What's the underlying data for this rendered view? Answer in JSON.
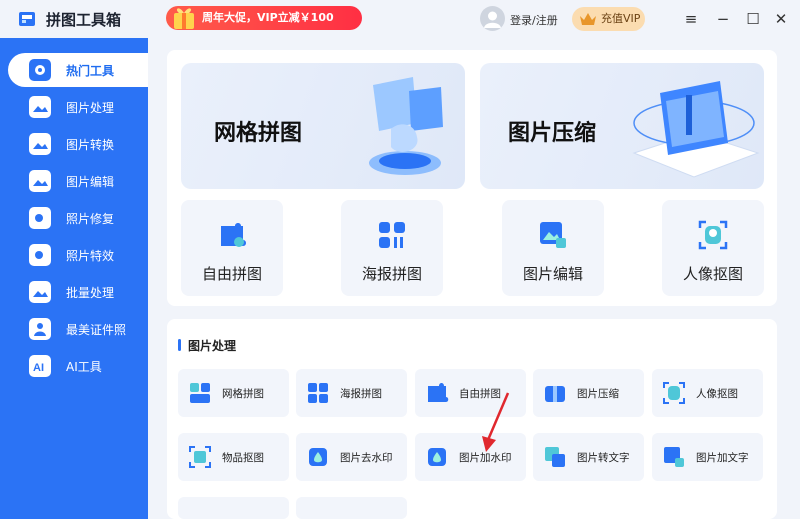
{
  "app": {
    "title": "拼图工具箱"
  },
  "header": {
    "promo_text": "周年大促，VIP立减￥100",
    "login_label": "登录/注册",
    "vip_label": "充值VIP",
    "window_controls": [
      "≡",
      "−",
      "☐",
      "✕"
    ]
  },
  "sidebar": {
    "items": [
      {
        "label": "热门工具",
        "icon": "gear-icon",
        "active": true
      },
      {
        "label": "图片处理",
        "icon": "image-process-icon"
      },
      {
        "label": "图片转换",
        "icon": "image-convert-icon"
      },
      {
        "label": "图片编辑",
        "icon": "image-edit-icon"
      },
      {
        "label": "照片修复",
        "icon": "photo-repair-icon"
      },
      {
        "label": "照片特效",
        "icon": "photo-effect-icon"
      },
      {
        "label": "批量处理",
        "icon": "batch-icon"
      },
      {
        "label": "最美证件照",
        "icon": "id-photo-icon"
      },
      {
        "label": "AI工具",
        "icon": "ai-icon"
      }
    ]
  },
  "hero": {
    "grid_collage": "网格拼图",
    "compress": "图片压缩"
  },
  "tools": [
    {
      "label": "自由拼图",
      "icon": "puzzle-icon"
    },
    {
      "label": "海报拼图",
      "icon": "poster-grid-icon"
    },
    {
      "label": "图片编辑",
      "icon": "image-edit-icon"
    },
    {
      "label": "人像抠图",
      "icon": "portrait-cutout-icon"
    }
  ],
  "section": {
    "title": "图片处理",
    "items": [
      {
        "label": "网格拼图",
        "icon": "grid-collage-icon"
      },
      {
        "label": "海报拼图",
        "icon": "poster-collage-icon"
      },
      {
        "label": "自由拼图",
        "icon": "free-collage-icon"
      },
      {
        "label": "图片压缩",
        "icon": "compress-icon"
      },
      {
        "label": "人像抠图",
        "icon": "portrait-icon"
      },
      {
        "label": "物品抠图",
        "icon": "object-cutout-icon"
      },
      {
        "label": "图片去水印",
        "icon": "remove-watermark-icon"
      },
      {
        "label": "图片加水印",
        "icon": "add-watermark-icon"
      },
      {
        "label": "图片转文字",
        "icon": "image-to-text-icon"
      },
      {
        "label": "图片加文字",
        "icon": "add-text-icon"
      }
    ]
  },
  "colors": {
    "accent": "#2b73f5",
    "annotation": "#e0282e"
  }
}
